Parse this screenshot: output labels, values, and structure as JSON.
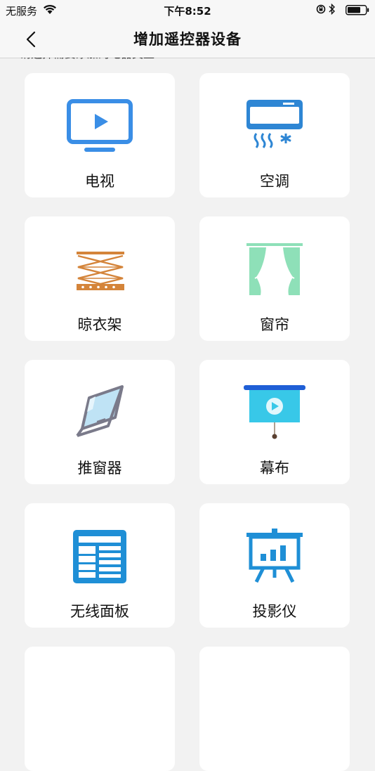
{
  "status_bar": {
    "carrier": "无服务",
    "time": "下午8:52"
  },
  "nav": {
    "title": "增加遥控器设备"
  },
  "hint": "请选择需要添加的电器类型",
  "devices": [
    {
      "label": "电视",
      "icon": "tv-icon",
      "color": "#3a8ee6"
    },
    {
      "label": "空调",
      "icon": "air-conditioner-icon",
      "color": "#2e86d4"
    },
    {
      "label": "晾衣架",
      "icon": "clothes-rack-icon",
      "color": "#d4843a"
    },
    {
      "label": "窗帘",
      "icon": "curtain-icon",
      "color": "#8ee0b8"
    },
    {
      "label": "推窗器",
      "icon": "window-opener-icon",
      "color": "#7a7a8a"
    },
    {
      "label": "幕布",
      "icon": "projector-screen-icon",
      "color": "#38c8e8"
    },
    {
      "label": "无线面板",
      "icon": "wireless-panel-icon",
      "color": "#1f8fd6"
    },
    {
      "label": "投影仪",
      "icon": "projector-icon",
      "color": "#1f8fd6"
    }
  ]
}
